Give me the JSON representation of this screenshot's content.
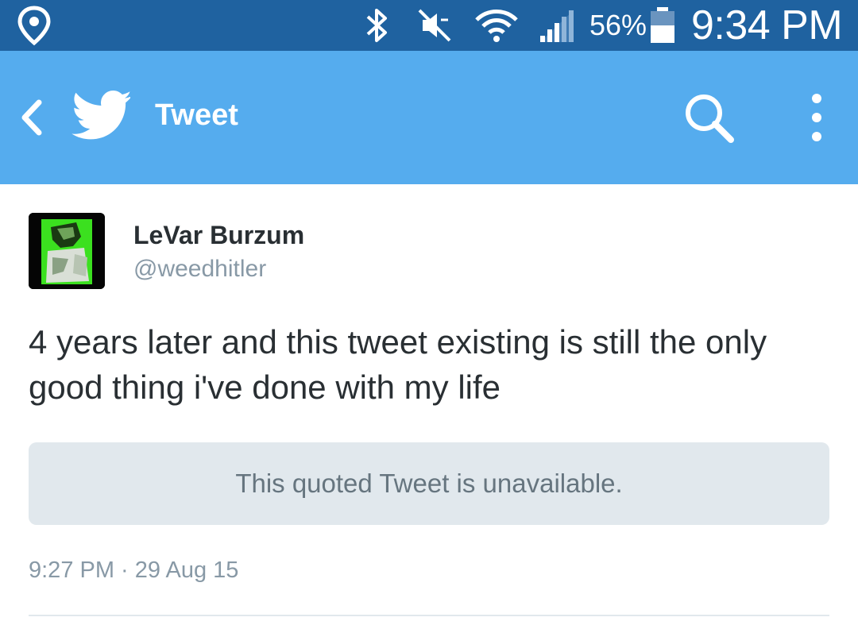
{
  "status_bar": {
    "battery_percent": "56%",
    "time": "9:34 PM",
    "icons": [
      "location-icon",
      "bluetooth-icon",
      "mute-icon",
      "wifi-icon",
      "signal-icon",
      "battery-icon"
    ]
  },
  "app_bar": {
    "title": "Tweet",
    "background_color": "#55acee",
    "icons": [
      "back-icon",
      "twitter-bird-icon",
      "search-icon",
      "overflow-menu-icon"
    ]
  },
  "tweet": {
    "display_name": "LeVar Burzum",
    "handle": "@weedhitler",
    "text": "4 years later and this tweet existing is still the only good thing i've done with my life",
    "quoted_tweet": "This quoted Tweet is unavailable.",
    "timestamp": "9:27 PM · 29 Aug 15"
  },
  "colors": {
    "status_bar": "#1f62a0",
    "accent": "#55acee",
    "text_primary": "#292f33",
    "text_secondary": "#8899a6",
    "quote_bg": "#e1e8ed"
  }
}
